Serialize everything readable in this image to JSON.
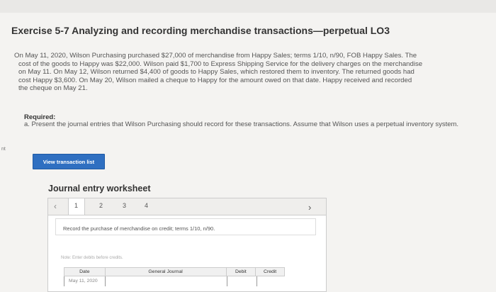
{
  "exercise": {
    "title": "Exercise 5-7 Analyzing and recording merchandise transactions—perpetual LO3",
    "problem_lines": [
      "On May 11, 2020, Wilson Purchasing purchased $27,000 of merchandise from Happy Sales; terms 1/10, n/90, FOB Happy Sales. The",
      "cost of the goods to Happy was $22,000. Wilson paid $1,700 to Express Shipping Service for the delivery charges on the merchandise",
      "on May 11. On May 12, Wilson returned $4,400 of goods to Happy Sales, which restored them to inventory. The returned goods had",
      "cost Happy $3,600. On May 20, Wilson mailed a cheque to Happy for the amount owed on that date. Happy received and recorded",
      "the cheque on May 21."
    ],
    "required_label": "Required:",
    "required_text": "a. Present the journal entries that Wilson Purchasing should record for these transactions. Assume that Wilson uses a perpetual inventory system."
  },
  "edge_mark": "nt",
  "buttons": {
    "view_transaction_list": "View transaction list"
  },
  "worksheet": {
    "title": "Journal entry worksheet",
    "pages": [
      "1",
      "2",
      "3",
      "4"
    ],
    "active_page": 1,
    "prev_icon": "chevron-left-icon",
    "next_icon": "chevron-right-icon",
    "instruction": "Record the purchase of merchandise on credit; terms 1/10, n/90.",
    "note": "Note: Enter debits before credits.",
    "columns": [
      "Date",
      "General Journal",
      "Debit",
      "Credit"
    ],
    "first_row_date": "May 11, 2020"
  },
  "colors": {
    "accent": "#2f6fc1"
  }
}
